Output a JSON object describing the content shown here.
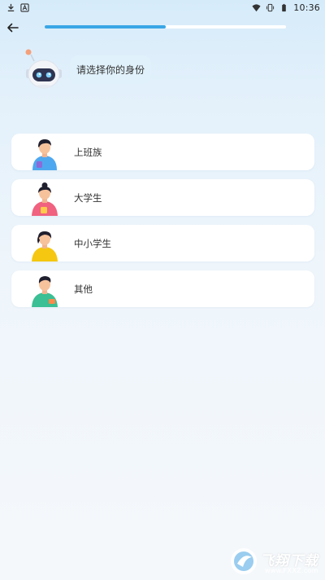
{
  "status_bar": {
    "time": "10:36",
    "left_icons": [
      "download-icon",
      "text-a-icon"
    ],
    "right_icons": [
      "wifi-icon",
      "vibrate-icon",
      "battery-icon"
    ]
  },
  "header": {
    "back_icon": "arrow-left-icon",
    "progress_fraction": 0.5
  },
  "prompt": {
    "text": "请选择你的身份"
  },
  "options": [
    {
      "label": "上班族",
      "avatar": "office-worker-avatar"
    },
    {
      "label": "大学生",
      "avatar": "college-student-avatar"
    },
    {
      "label": "中小学生",
      "avatar": "school-student-avatar"
    },
    {
      "label": "其他",
      "avatar": "other-avatar"
    }
  ],
  "watermark": {
    "text": "飞翔下载",
    "url": "www.FXXZ.com"
  },
  "colors": {
    "accent": "#3aa6e6",
    "bubble": "#e0f1fb",
    "card": "#ffffff"
  }
}
